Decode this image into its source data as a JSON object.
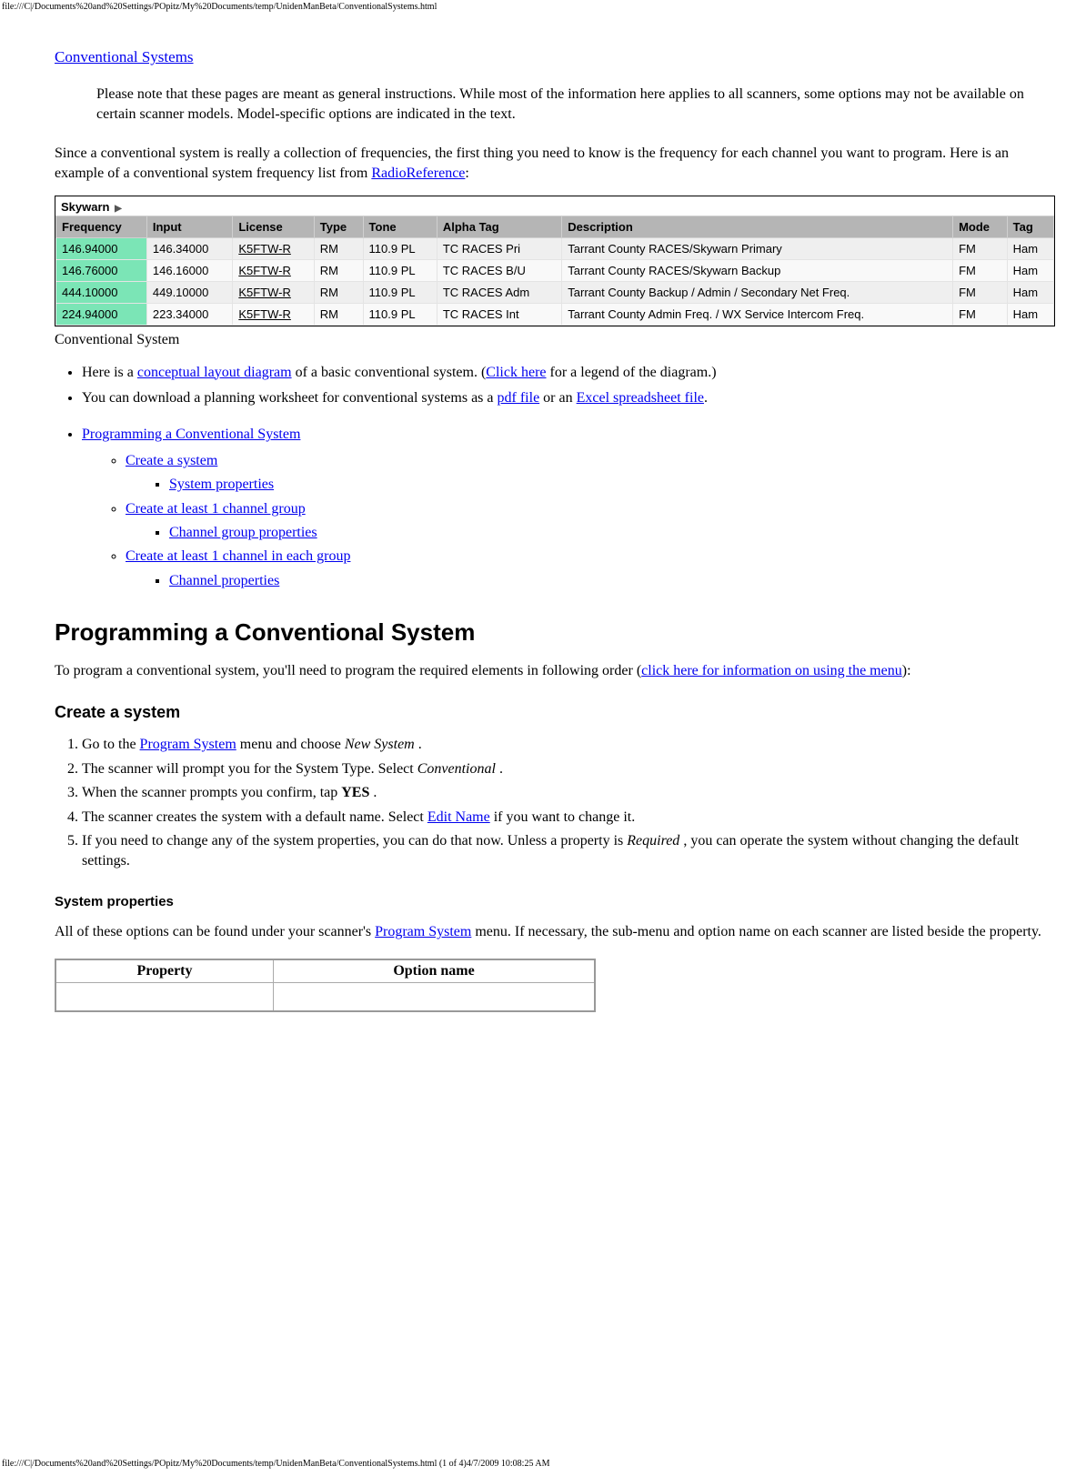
{
  "header_path": "file:///C|/Documents%20and%20Settings/POpitz/My%20Documents/temp/UnidenManBeta/ConventionalSystems.html",
  "footer_path": "file:///C|/Documents%20and%20Settings/POpitz/My%20Documents/temp/UnidenManBeta/ConventionalSystems.html (1 of 4)4/7/2009 10:08:25 AM",
  "title_link": "Conventional Systems",
  "note": "Please note that these pages are meant as general instructions. While most of the information here applies to all scanners, some options may not be available on certain scanner models. Model-specific options are indicated in the text.",
  "intro_part1": "Since a conventional system is really a collection of frequencies, the first thing you need to know is the frequency for each channel you want to program. Here is an example of a conventional system frequency list from ",
  "intro_link": "RadioReference",
  "intro_part2": ":",
  "skywarn": {
    "title": "Skywarn",
    "headers": [
      "Frequency",
      "Input",
      "License",
      "Type",
      "Tone",
      "Alpha Tag",
      "Description",
      "Mode",
      "Tag"
    ],
    "rows": [
      {
        "freq": "146.94000",
        "input": "146.34000",
        "license": "K5FTW-R",
        "type": "RM",
        "tone": "110.9 PL",
        "alpha": "TC RACES Pri",
        "desc": "Tarrant County RACES/Skywarn Primary",
        "mode": "FM",
        "tag": "Ham"
      },
      {
        "freq": "146.76000",
        "input": "146.16000",
        "license": "K5FTW-R",
        "type": "RM",
        "tone": "110.9 PL",
        "alpha": "TC RACES B/U",
        "desc": "Tarrant County RACES/Skywarn Backup",
        "mode": "FM",
        "tag": "Ham"
      },
      {
        "freq": "444.10000",
        "input": "449.10000",
        "license": "K5FTW-R",
        "type": "RM",
        "tone": "110.9 PL",
        "alpha": "TC RACES Adm",
        "desc": "Tarrant County Backup / Admin / Secondary Net Freq.",
        "mode": "FM",
        "tag": "Ham"
      },
      {
        "freq": "224.94000",
        "input": "223.34000",
        "license": "K5FTW-R",
        "type": "RM",
        "tone": "110.9 PL",
        "alpha": "TC RACES Int",
        "desc": "Tarrant County Admin Freq. / WX Service Intercom Freq.",
        "mode": "FM",
        "tag": "Ham"
      }
    ]
  },
  "caption": "Conventional System",
  "bullets": {
    "b1_p1": "Here is a ",
    "b1_link1": "conceptual layout diagram",
    "b1_p2": " of a basic conventional system. (",
    "b1_link2": "Click here",
    "b1_p3": " for a legend of the diagram.)",
    "b2_p1": "You can download a planning worksheet for conventional systems as a ",
    "b2_link1": "pdf file",
    "b2_p2": " or an ",
    "b2_link2": "Excel spreadsheet file",
    "b2_p3": "."
  },
  "toc": {
    "prog": "Programming a Conventional System",
    "create_sys": "Create a system",
    "sys_props": "System properties",
    "create_group": "Create at least 1 channel group",
    "group_props": "Channel group properties",
    "create_channel": "Create at least 1 channel in each group",
    "channel_props": "Channel properties"
  },
  "h2_prog": "Programming a Conventional System",
  "prog_intro_p1": "To program a conventional system, you'll need to program the required elements in following order (",
  "prog_intro_link": "click here for information on using the menu",
  "prog_intro_p2": "):",
  "h3_create": "Create a system",
  "steps": {
    "s1_p1": "Go to the ",
    "s1_link": "Program System",
    "s1_p2": " menu and choose ",
    "s1_italic": "New System",
    "s1_p3": " .",
    "s2_p1": "The scanner will prompt you for the System Type. Select ",
    "s2_italic": "Conventional",
    "s2_p2": " .",
    "s3_p1": "When the scanner prompts you confirm, tap ",
    "s3_bold": "YES",
    "s3_p2": " .",
    "s4_p1": "The scanner creates the system with a default name. Select ",
    "s4_link": "Edit Name",
    "s4_p2": " if you want to change it.",
    "s5_p1": "If you need to change any of the system properties, you can do that now. Unless a property is ",
    "s5_italic": "Required",
    "s5_p2": " , you can operate the system without changing the default settings."
  },
  "h4_sysprops": "System properties",
  "sysprops_p1": "All of these options can be found under your scanner's ",
  "sysprops_link": "Program System",
  "sysprops_p2": " menu. If necessary, the sub-menu and option name on each scanner are listed beside the property.",
  "prop_table": {
    "h1": "Property",
    "h2": "Option name"
  }
}
